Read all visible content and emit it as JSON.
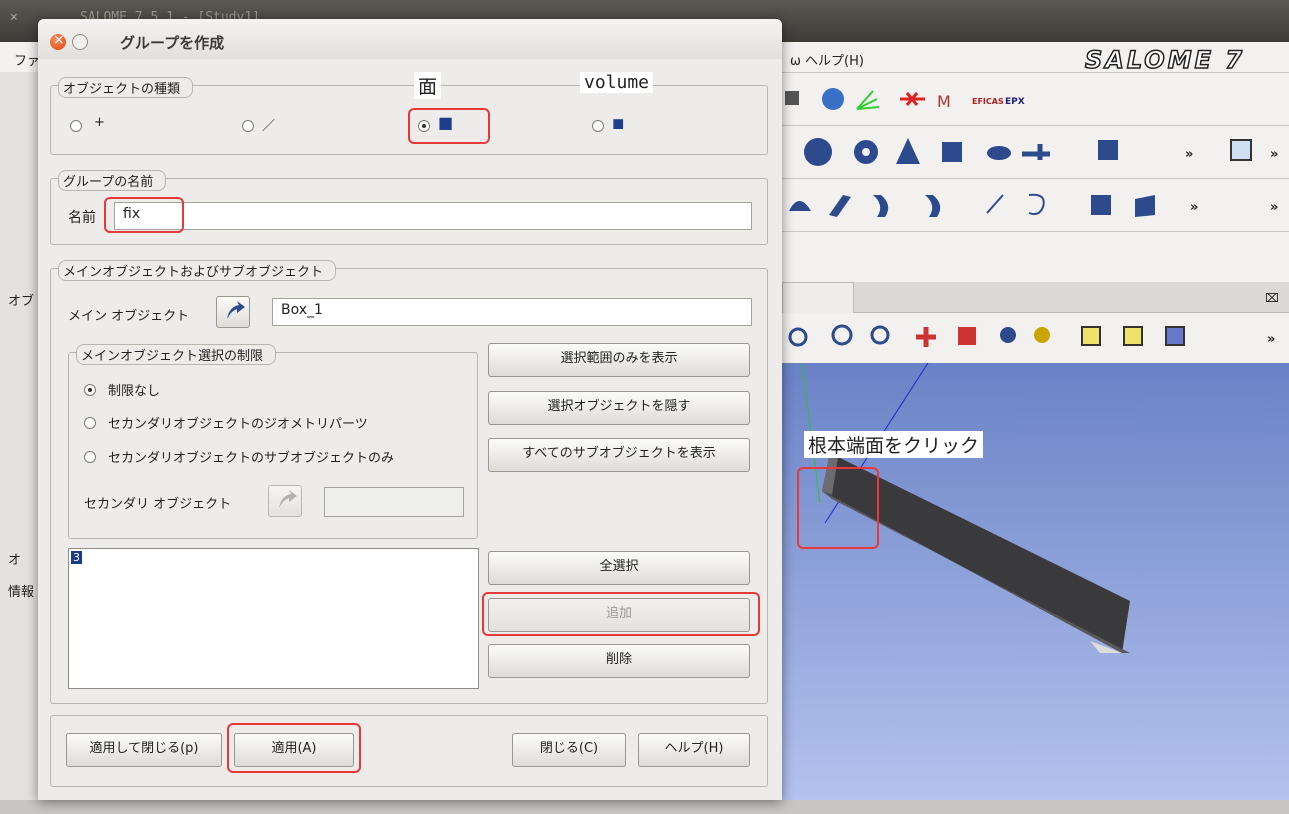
{
  "background_window": {
    "title": "SALOME 7.5.1 - [Study1]",
    "menu_file": "ファ",
    "menu_help": "ω ヘルプ(H)",
    "logo": "SALOME 7",
    "panel_obj": "オブ",
    "panel_info": "情報",
    "panel_tab": "オ",
    "close_x": "×",
    "viewer_close": "⌧",
    "overflow": "»"
  },
  "dialog": {
    "title": "グループを作成",
    "shape_type": {
      "label": "オブジェクトの種類",
      "options": [
        {
          "glyph": "+",
          "selected": false
        },
        {
          "glyph": "／",
          "selected": false
        },
        {
          "glyph": "■",
          "selected": true
        },
        {
          "glyph": "◼",
          "selected": false
        }
      ]
    },
    "group_name": {
      "label": "グループの名前",
      "field_label": "名前",
      "value": "fix"
    },
    "main_sub": {
      "label": "メインオブジェクトおよびサブオブジェクト",
      "main_object_label": "メイン オブジェクト",
      "main_object_value": "Box_1",
      "restrict_label": "メインオブジェクト選択の制限",
      "restrict_options": [
        {
          "label": "制限なし",
          "selected": true
        },
        {
          "label": "セカンダリオブジェクトのジオメトリパーツ",
          "selected": false
        },
        {
          "label": "セカンダリオブジェクトのサブオブジェクトのみ",
          "selected": false
        }
      ],
      "secondary_label": "セカンダリ オブジェクト",
      "secondary_value": "",
      "btn_show_selected": "選択範囲のみを表示",
      "btn_hide_selected": "選択オブジェクトを隠す",
      "btn_show_all": "すべてのサブオブジェクトを表示",
      "list_items": [
        "3"
      ],
      "btn_select_all": "全選択",
      "btn_add": "追加",
      "btn_remove": "削除"
    },
    "footer": {
      "apply_close": "適用して閉じる(p)",
      "apply": "適用(A)",
      "close": "閉じる(C)",
      "help": "ヘルプ(H)"
    }
  },
  "annotations": {
    "face": "面",
    "volume": "volume",
    "click_face": "根本端面をクリック"
  }
}
